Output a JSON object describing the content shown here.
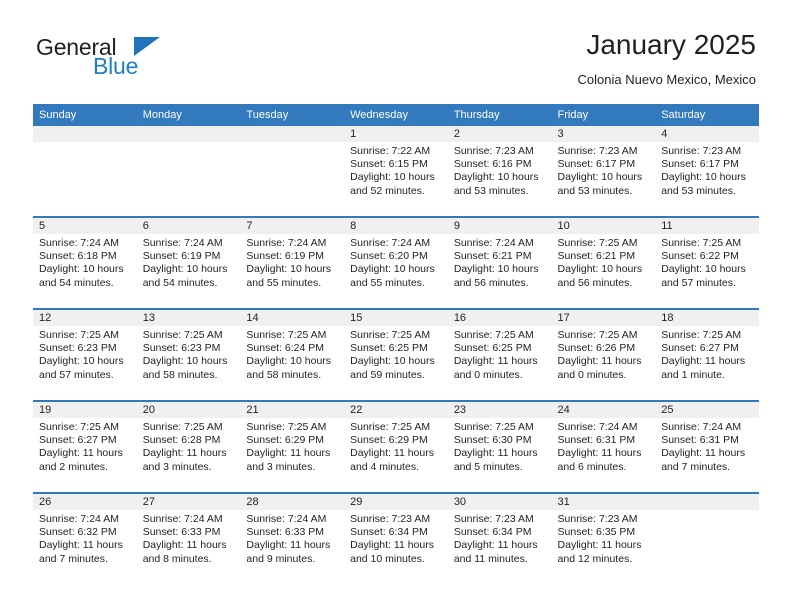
{
  "logo": {
    "line1": "General",
    "line2": "Blue",
    "triangle_color": "#1f74bb",
    "line2_color": "#1f7ec4"
  },
  "header": {
    "title": "January 2025",
    "subtitle": "Colonia Nuevo Mexico, Mexico"
  },
  "colors": {
    "header_row_bg": "#3279bd",
    "day_number_bg": "#f0f0f0",
    "text": "#231f20",
    "page_bg": "#ffffff"
  },
  "calendar": {
    "weekday_headers": [
      "Sunday",
      "Monday",
      "Tuesday",
      "Wednesday",
      "Thursday",
      "Friday",
      "Saturday"
    ],
    "weeks": [
      [
        {
          "day": "",
          "empty": true,
          "sunrise": "",
          "sunset": "",
          "daylight_l1": "",
          "daylight_l2": ""
        },
        {
          "day": "",
          "empty": true,
          "sunrise": "",
          "sunset": "",
          "daylight_l1": "",
          "daylight_l2": ""
        },
        {
          "day": "",
          "empty": true,
          "sunrise": "",
          "sunset": "",
          "daylight_l1": "",
          "daylight_l2": ""
        },
        {
          "day": "1",
          "empty": false,
          "sunrise": "Sunrise: 7:22 AM",
          "sunset": "Sunset: 6:15 PM",
          "daylight_l1": "Daylight: 10 hours",
          "daylight_l2": "and 52 minutes."
        },
        {
          "day": "2",
          "empty": false,
          "sunrise": "Sunrise: 7:23 AM",
          "sunset": "Sunset: 6:16 PM",
          "daylight_l1": "Daylight: 10 hours",
          "daylight_l2": "and 53 minutes."
        },
        {
          "day": "3",
          "empty": false,
          "sunrise": "Sunrise: 7:23 AM",
          "sunset": "Sunset: 6:17 PM",
          "daylight_l1": "Daylight: 10 hours",
          "daylight_l2": "and 53 minutes."
        },
        {
          "day": "4",
          "empty": false,
          "sunrise": "Sunrise: 7:23 AM",
          "sunset": "Sunset: 6:17 PM",
          "daylight_l1": "Daylight: 10 hours",
          "daylight_l2": "and 53 minutes."
        }
      ],
      [
        {
          "day": "5",
          "empty": false,
          "sunrise": "Sunrise: 7:24 AM",
          "sunset": "Sunset: 6:18 PM",
          "daylight_l1": "Daylight: 10 hours",
          "daylight_l2": "and 54 minutes."
        },
        {
          "day": "6",
          "empty": false,
          "sunrise": "Sunrise: 7:24 AM",
          "sunset": "Sunset: 6:19 PM",
          "daylight_l1": "Daylight: 10 hours",
          "daylight_l2": "and 54 minutes."
        },
        {
          "day": "7",
          "empty": false,
          "sunrise": "Sunrise: 7:24 AM",
          "sunset": "Sunset: 6:19 PM",
          "daylight_l1": "Daylight: 10 hours",
          "daylight_l2": "and 55 minutes."
        },
        {
          "day": "8",
          "empty": false,
          "sunrise": "Sunrise: 7:24 AM",
          "sunset": "Sunset: 6:20 PM",
          "daylight_l1": "Daylight: 10 hours",
          "daylight_l2": "and 55 minutes."
        },
        {
          "day": "9",
          "empty": false,
          "sunrise": "Sunrise: 7:24 AM",
          "sunset": "Sunset: 6:21 PM",
          "daylight_l1": "Daylight: 10 hours",
          "daylight_l2": "and 56 minutes."
        },
        {
          "day": "10",
          "empty": false,
          "sunrise": "Sunrise: 7:25 AM",
          "sunset": "Sunset: 6:21 PM",
          "daylight_l1": "Daylight: 10 hours",
          "daylight_l2": "and 56 minutes."
        },
        {
          "day": "11",
          "empty": false,
          "sunrise": "Sunrise: 7:25 AM",
          "sunset": "Sunset: 6:22 PM",
          "daylight_l1": "Daylight: 10 hours",
          "daylight_l2": "and 57 minutes."
        }
      ],
      [
        {
          "day": "12",
          "empty": false,
          "sunrise": "Sunrise: 7:25 AM",
          "sunset": "Sunset: 6:23 PM",
          "daylight_l1": "Daylight: 10 hours",
          "daylight_l2": "and 57 minutes."
        },
        {
          "day": "13",
          "empty": false,
          "sunrise": "Sunrise: 7:25 AM",
          "sunset": "Sunset: 6:23 PM",
          "daylight_l1": "Daylight: 10 hours",
          "daylight_l2": "and 58 minutes."
        },
        {
          "day": "14",
          "empty": false,
          "sunrise": "Sunrise: 7:25 AM",
          "sunset": "Sunset: 6:24 PM",
          "daylight_l1": "Daylight: 10 hours",
          "daylight_l2": "and 58 minutes."
        },
        {
          "day": "15",
          "empty": false,
          "sunrise": "Sunrise: 7:25 AM",
          "sunset": "Sunset: 6:25 PM",
          "daylight_l1": "Daylight: 10 hours",
          "daylight_l2": "and 59 minutes."
        },
        {
          "day": "16",
          "empty": false,
          "sunrise": "Sunrise: 7:25 AM",
          "sunset": "Sunset: 6:25 PM",
          "daylight_l1": "Daylight: 11 hours",
          "daylight_l2": "and 0 minutes."
        },
        {
          "day": "17",
          "empty": false,
          "sunrise": "Sunrise: 7:25 AM",
          "sunset": "Sunset: 6:26 PM",
          "daylight_l1": "Daylight: 11 hours",
          "daylight_l2": "and 0 minutes."
        },
        {
          "day": "18",
          "empty": false,
          "sunrise": "Sunrise: 7:25 AM",
          "sunset": "Sunset: 6:27 PM",
          "daylight_l1": "Daylight: 11 hours",
          "daylight_l2": "and 1 minute."
        }
      ],
      [
        {
          "day": "19",
          "empty": false,
          "sunrise": "Sunrise: 7:25 AM",
          "sunset": "Sunset: 6:27 PM",
          "daylight_l1": "Daylight: 11 hours",
          "daylight_l2": "and 2 minutes."
        },
        {
          "day": "20",
          "empty": false,
          "sunrise": "Sunrise: 7:25 AM",
          "sunset": "Sunset: 6:28 PM",
          "daylight_l1": "Daylight: 11 hours",
          "daylight_l2": "and 3 minutes."
        },
        {
          "day": "21",
          "empty": false,
          "sunrise": "Sunrise: 7:25 AM",
          "sunset": "Sunset: 6:29 PM",
          "daylight_l1": "Daylight: 11 hours",
          "daylight_l2": "and 3 minutes."
        },
        {
          "day": "22",
          "empty": false,
          "sunrise": "Sunrise: 7:25 AM",
          "sunset": "Sunset: 6:29 PM",
          "daylight_l1": "Daylight: 11 hours",
          "daylight_l2": "and 4 minutes."
        },
        {
          "day": "23",
          "empty": false,
          "sunrise": "Sunrise: 7:25 AM",
          "sunset": "Sunset: 6:30 PM",
          "daylight_l1": "Daylight: 11 hours",
          "daylight_l2": "and 5 minutes."
        },
        {
          "day": "24",
          "empty": false,
          "sunrise": "Sunrise: 7:24 AM",
          "sunset": "Sunset: 6:31 PM",
          "daylight_l1": "Daylight: 11 hours",
          "daylight_l2": "and 6 minutes."
        },
        {
          "day": "25",
          "empty": false,
          "sunrise": "Sunrise: 7:24 AM",
          "sunset": "Sunset: 6:31 PM",
          "daylight_l1": "Daylight: 11 hours",
          "daylight_l2": "and 7 minutes."
        }
      ],
      [
        {
          "day": "26",
          "empty": false,
          "sunrise": "Sunrise: 7:24 AM",
          "sunset": "Sunset: 6:32 PM",
          "daylight_l1": "Daylight: 11 hours",
          "daylight_l2": "and 7 minutes."
        },
        {
          "day": "27",
          "empty": false,
          "sunrise": "Sunrise: 7:24 AM",
          "sunset": "Sunset: 6:33 PM",
          "daylight_l1": "Daylight: 11 hours",
          "daylight_l2": "and 8 minutes."
        },
        {
          "day": "28",
          "empty": false,
          "sunrise": "Sunrise: 7:24 AM",
          "sunset": "Sunset: 6:33 PM",
          "daylight_l1": "Daylight: 11 hours",
          "daylight_l2": "and 9 minutes."
        },
        {
          "day": "29",
          "empty": false,
          "sunrise": "Sunrise: 7:23 AM",
          "sunset": "Sunset: 6:34 PM",
          "daylight_l1": "Daylight: 11 hours",
          "daylight_l2": "and 10 minutes."
        },
        {
          "day": "30",
          "empty": false,
          "sunrise": "Sunrise: 7:23 AM",
          "sunset": "Sunset: 6:34 PM",
          "daylight_l1": "Daylight: 11 hours",
          "daylight_l2": "and 11 minutes."
        },
        {
          "day": "31",
          "empty": false,
          "sunrise": "Sunrise: 7:23 AM",
          "sunset": "Sunset: 6:35 PM",
          "daylight_l1": "Daylight: 11 hours",
          "daylight_l2": "and 12 minutes."
        },
        {
          "day": "",
          "empty": true,
          "sunrise": "",
          "sunset": "",
          "daylight_l1": "",
          "daylight_l2": ""
        }
      ]
    ]
  }
}
